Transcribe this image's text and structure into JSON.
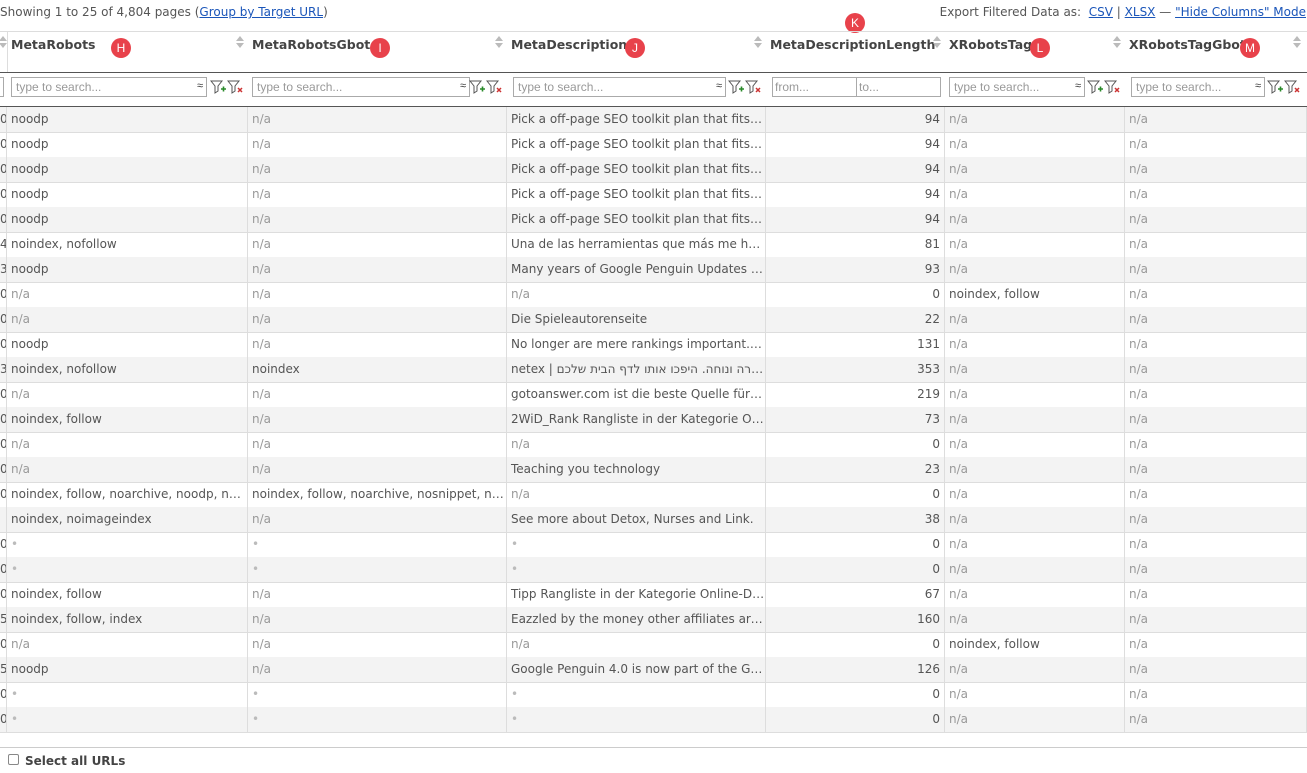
{
  "summary": {
    "showing_text": "Showing 1 to 25 of 4,804 pages (",
    "group_link": "Group by Target URL",
    "close_paren": ")"
  },
  "export": {
    "label": "Export Filtered Data as:",
    "csv": "CSV",
    "pipe": "|",
    "xlsx": "XLSX",
    "dash": "—",
    "hide_columns": "\"Hide Columns\" Mode"
  },
  "columns": [
    {
      "title": "MetaRobots",
      "badge": "H"
    },
    {
      "title": "MetaRobotsGbot",
      "badge": "I"
    },
    {
      "title": "MetaDescription",
      "badge": "J"
    },
    {
      "title": "MetaDescriptionLength",
      "badge": "K"
    },
    {
      "title": "XRobotsTag",
      "badge": "L"
    },
    {
      "title": "XRobotsTagGbot",
      "badge": "M"
    }
  ],
  "filters": {
    "search_placeholder": "type to search...",
    "wave": "≈",
    "from_placeholder": "from...",
    "to_placeholder": "to..."
  },
  "rows": [
    {
      "lead": "0",
      "c1": "noodp",
      "c2": "n/a",
      "c3": "Pick a off-page SEO toolkit plan that fits to ...",
      "c4": "94",
      "c5": "n/a",
      "c6": "n/a"
    },
    {
      "lead": "0",
      "c1": "noodp",
      "c2": "n/a",
      "c3": "Pick a off-page SEO toolkit plan that fits to ...",
      "c4": "94",
      "c5": "n/a",
      "c6": "n/a"
    },
    {
      "lead": "0",
      "c1": "noodp",
      "c2": "n/a",
      "c3": "Pick a off-page SEO toolkit plan that fits to ...",
      "c4": "94",
      "c5": "n/a",
      "c6": "n/a"
    },
    {
      "lead": "0",
      "c1": "noodp",
      "c2": "n/a",
      "c3": "Pick a off-page SEO toolkit plan that fits to ...",
      "c4": "94",
      "c5": "n/a",
      "c6": "n/a"
    },
    {
      "lead": "0",
      "c1": "noodp",
      "c2": "n/a",
      "c3": "Pick a off-page SEO toolkit plan that fits to ...",
      "c4": "94",
      "c5": "n/a",
      "c6": "n/a"
    },
    {
      "lead": "4",
      "c1": "noindex, nofollow",
      "c2": "n/a",
      "c3": "Una de las herramientas que más me ha i...",
      "c4": "81",
      "c5": "n/a",
      "c6": "n/a"
    },
    {
      "lead": "3",
      "c1": "noodp",
      "c2": "n/a",
      "c3": "Many years of Google Penguin Updates Co...",
      "c4": "93",
      "c5": "n/a",
      "c6": "n/a"
    },
    {
      "lead": "0",
      "c1": "n/a",
      "c2": "n/a",
      "c3": "n/a",
      "c4": "0",
      "c5": "noindex, follow",
      "c6": "n/a"
    },
    {
      "lead": "0",
      "c1": "n/a",
      "c2": "n/a",
      "c3": "Die Spieleautorenseite",
      "c4": "22",
      "c5": "n/a",
      "c6": "n/a"
    },
    {
      "lead": "0",
      "c1": "noodp",
      "c2": "n/a",
      "c3": "No longer are mere rankings important. N...",
      "c4": "131",
      "c5": "n/a",
      "c6": "n/a"
    },
    {
      "lead": "3",
      "c1": "noindex, nofollow",
      "c2": "noindex",
      "c3": "netex | ה ישירה ונוחה. היפכו אותו לדף הבית שלכם",
      "c4": "353",
      "c5": "n/a",
      "c6": "n/a"
    },
    {
      "lead": "0",
      "c1": "n/a",
      "c2": "n/a",
      "c3": "gotoanswer.com ist die beste Quelle für all...",
      "c4": "219",
      "c5": "n/a",
      "c6": "n/a"
    },
    {
      "lead": "0",
      "c1": "noindex, follow",
      "c2": "n/a",
      "c3": "2WiD_Rank Rangliste in der Kategorie Onli...",
      "c4": "73",
      "c5": "n/a",
      "c6": "n/a"
    },
    {
      "lead": "0",
      "c1": "n/a",
      "c2": "n/a",
      "c3": "n/a",
      "c4": "0",
      "c5": "n/a",
      "c6": "n/a"
    },
    {
      "lead": "0",
      "c1": "n/a",
      "c2": "n/a",
      "c3": "Teaching you technology",
      "c4": "23",
      "c5": "n/a",
      "c6": "n/a"
    },
    {
      "lead": "0",
      "c1": "noindex, follow, noarchive, noodp, noydir",
      "c2": "noindex, follow, noarchive, nosnippet, noo...",
      "c3": "n/a",
      "c4": "0",
      "c5": "n/a",
      "c6": "n/a"
    },
    {
      "lead": "",
      "c1": "noindex, noimageindex",
      "c2": "n/a",
      "c3": "See more about Detox, Nurses and Link.",
      "c4": "38",
      "c5": "n/a",
      "c6": "n/a"
    },
    {
      "lead": "0",
      "c1": "•",
      "c2": "•",
      "c3": "•",
      "c4": "0",
      "c5": "n/a",
      "c6": "n/a"
    },
    {
      "lead": "0",
      "c1": "•",
      "c2": "•",
      "c3": "•",
      "c4": "0",
      "c5": "n/a",
      "c6": "n/a"
    },
    {
      "lead": "0",
      "c1": "noindex, follow",
      "c2": "n/a",
      "c3": "Tipp Rangliste in der Kategorie Online-Dien...",
      "c4": "67",
      "c5": "n/a",
      "c6": "n/a"
    },
    {
      "lead": "5",
      "c1": "noindex, follow, index",
      "c2": "n/a",
      "c3": "Eazzled by the money other affiliates are cl...",
      "c4": "160",
      "c5": "n/a",
      "c6": "n/a"
    },
    {
      "lead": "0",
      "c1": "n/a",
      "c2": "n/a",
      "c3": "n/a",
      "c4": "0",
      "c5": "noindex, follow",
      "c6": "n/a"
    },
    {
      "lead": "5",
      "c1": "noodp",
      "c2": "n/a",
      "c3": "Google Penguin 4.0 is now part of the Goo...",
      "c4": "126",
      "c5": "n/a",
      "c6": "n/a"
    },
    {
      "lead": "0",
      "c1": "•",
      "c2": "•",
      "c3": "•",
      "c4": "0",
      "c5": "n/a",
      "c6": "n/a"
    },
    {
      "lead": "0",
      "c1": "•",
      "c2": "•",
      "c3": "•",
      "c4": "0",
      "c5": "n/a",
      "c6": "n/a"
    }
  ],
  "footer": {
    "select_all": "Select all URLs"
  },
  "colors": {
    "badge": "#e8424b",
    "link": "#1a55b9",
    "row_alt": "#f3f3f3"
  }
}
